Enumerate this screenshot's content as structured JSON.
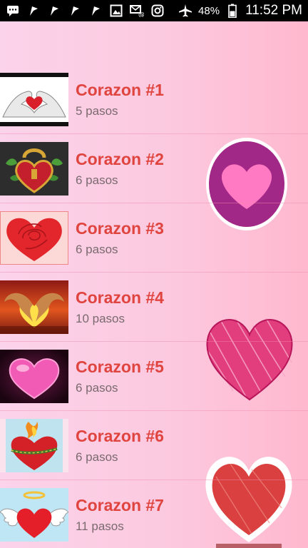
{
  "status_bar": {
    "battery": "48%",
    "time": "11:52 PM",
    "icons": [
      "message-icon",
      "flag-icon",
      "flag-icon",
      "flag-icon",
      "flag-icon",
      "image-icon",
      "email-icon",
      "instagram-icon",
      "airplane-mode-icon",
      "battery-icon"
    ]
  },
  "list": {
    "items": [
      {
        "title": "Corazon #1",
        "subtitle": "5 pasos",
        "thumbnail": "hands-heart-thumbnail"
      },
      {
        "title": "Corazon #2",
        "subtitle": "6 pasos",
        "thumbnail": "lock-heart-thumbnail"
      },
      {
        "title": "Corazon #3",
        "subtitle": "6 pasos",
        "thumbnail": "rose-heart-thumbnail"
      },
      {
        "title": "Corazon #4",
        "subtitle": "10 pasos",
        "thumbnail": "dolphins-heart-thumbnail"
      },
      {
        "title": "Corazon #5",
        "subtitle": "6 pasos",
        "thumbnail": "pink-heart-thumbnail"
      },
      {
        "title": "Corazon #6",
        "subtitle": "6 pasos",
        "thumbnail": "flaming-heart-thumbnail"
      },
      {
        "title": "Corazon #7",
        "subtitle": "11 pasos",
        "thumbnail": "winged-heart-thumbnail"
      }
    ]
  },
  "colors": {
    "title": "#e0443f",
    "subtitle": "#7a6a6e",
    "background": "#fcc9df"
  }
}
